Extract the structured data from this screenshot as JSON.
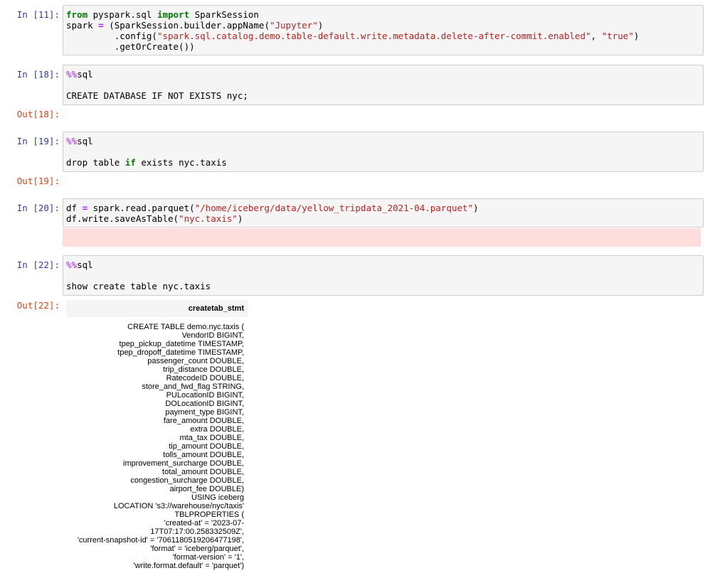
{
  "cells": [
    {
      "in_prompt": "In [11]:",
      "code_lines": [
        [
          {
            "t": "from",
            "c": "kw"
          },
          {
            "t": " pyspark.sql "
          },
          {
            "t": "import",
            "c": "kw"
          },
          {
            "t": " SparkSession"
          }
        ],
        [
          {
            "t": "spark "
          },
          {
            "t": "=",
            "c": "op"
          },
          {
            "t": " (SparkSession.builder.appName("
          },
          {
            "t": "\"Jupyter\"",
            "c": "str"
          },
          {
            "t": ")"
          }
        ],
        [
          {
            "t": "         .config("
          },
          {
            "t": "\"spark.sql.catalog.demo.table-default.write.metadata.delete-after-commit.enabled\"",
            "c": "str"
          },
          {
            "t": ", "
          },
          {
            "t": "\"true\"",
            "c": "str"
          },
          {
            "t": ")"
          }
        ],
        [
          {
            "t": "         .getOrCreate())"
          }
        ]
      ]
    },
    {
      "in_prompt": "In [18]:",
      "code_lines": [
        [
          {
            "t": "%%",
            "c": "magic"
          },
          {
            "t": "sql"
          }
        ],
        [
          {
            "t": ""
          }
        ],
        [
          {
            "t": "CREATE DATABASE IF NOT EXISTS nyc;"
          }
        ]
      ],
      "out_prompt": "Out[18]:"
    },
    {
      "in_prompt": "In [19]:",
      "code_lines": [
        [
          {
            "t": "%%",
            "c": "magic"
          },
          {
            "t": "sql"
          }
        ],
        [
          {
            "t": ""
          }
        ],
        [
          {
            "t": "drop table "
          },
          {
            "t": "if",
            "c": "kw"
          },
          {
            "t": " exists nyc.taxis"
          }
        ]
      ],
      "out_prompt": "Out[19]:"
    },
    {
      "in_prompt": "In [20]:",
      "code_lines": [
        [
          {
            "t": "df "
          },
          {
            "t": "=",
            "c": "op"
          },
          {
            "t": " spark.read.parquet("
          },
          {
            "t": "\"/home/iceberg/data/yellow_tripdata_2021-04.parquet\"",
            "c": "str"
          },
          {
            "t": ")"
          }
        ],
        [
          {
            "t": "df.write.saveAsTable("
          },
          {
            "t": "\"nyc.taxis\"",
            "c": "str"
          },
          {
            "t": ")"
          }
        ]
      ]
    },
    {
      "in_prompt": "In [22]:",
      "code_lines": [
        [
          {
            "t": "%%",
            "c": "magic"
          },
          {
            "t": "sql"
          }
        ],
        [
          {
            "t": ""
          }
        ],
        [
          {
            "t": "show create table nyc.taxis"
          }
        ]
      ],
      "out_prompt": "Out[22]:"
    }
  ],
  "result_table": {
    "header": "createtab_stmt",
    "statement": "CREATE TABLE demo.nyc.taxis (\nVendorID BIGINT,\ntpep_pickup_datetime TIMESTAMP,\ntpep_dropoff_datetime TIMESTAMP,\npassenger_count DOUBLE,\ntrip_distance DOUBLE,\nRatecodeID DOUBLE,\nstore_and_fwd_flag STRING,\nPULocationID BIGINT,\nDOLocationID BIGINT,\npayment_type BIGINT,\nfare_amount DOUBLE,\nextra DOUBLE,\nmta_tax DOUBLE,\ntip_amount DOUBLE,\ntolls_amount DOUBLE,\nimprovement_surcharge DOUBLE,\ntotal_amount DOUBLE,\ncongestion_surcharge DOUBLE,\nairport_fee DOUBLE)\nUSING iceberg\nLOCATION 's3://warehouse/nyc/taxis'\nTBLPROPERTIES (\n'created-at' = '2023-07-17T07:17:00.258332509Z',\n'current-snapshot-id' = '7061180519206477198',\n'format' = 'iceberg/parquet',\n'format-version' = '1',\n'write.format.default' = 'parquet')"
  }
}
